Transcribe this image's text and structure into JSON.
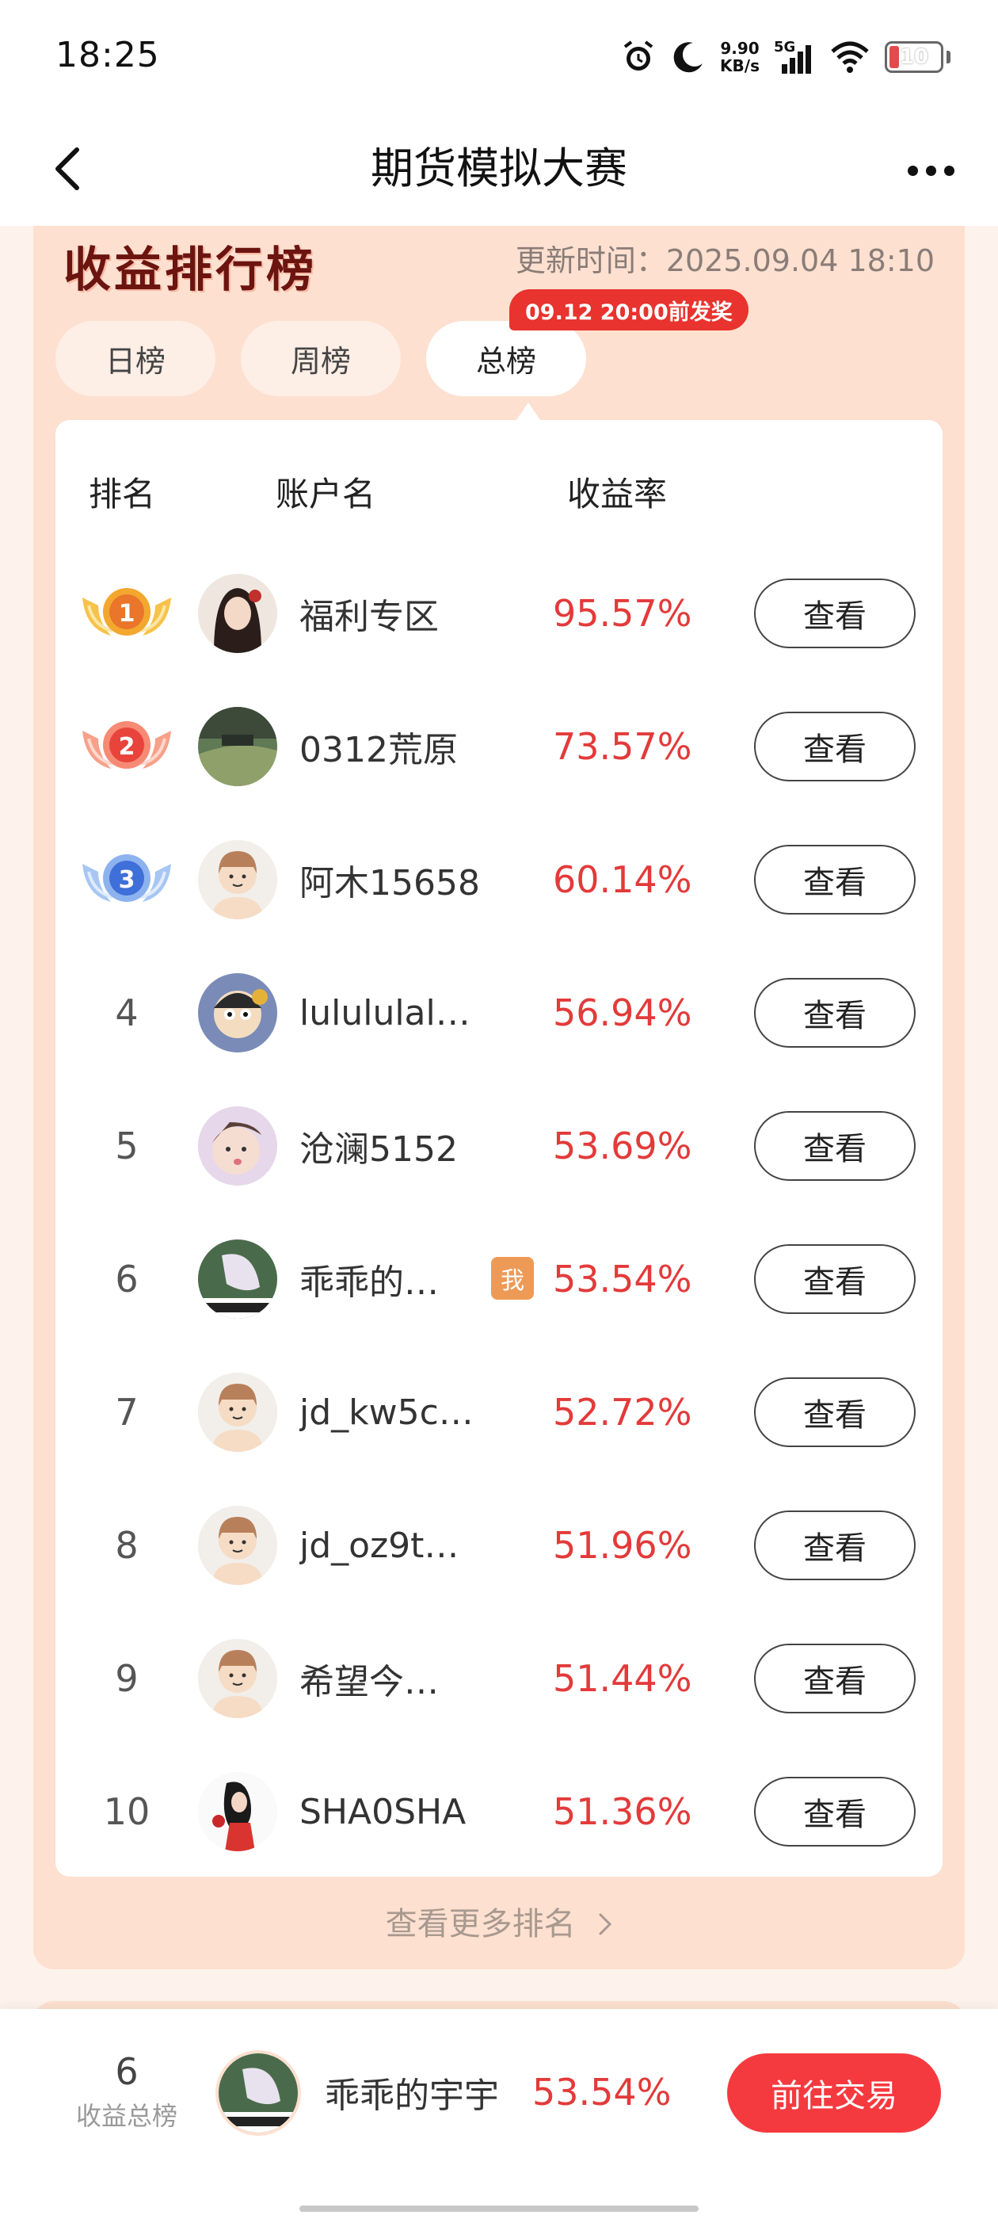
{
  "status_bar": {
    "time": "18:25",
    "net_speed_value": "9.90",
    "net_speed_unit": "KB/s",
    "signal_label": "5G",
    "battery": "10",
    "icons": [
      "alarm-icon",
      "moon-icon",
      "signal-icon",
      "wifi-icon",
      "battery-icon"
    ]
  },
  "header": {
    "title": "期货模拟大赛",
    "back_icon": "back-arrow-icon",
    "more_icon": "more-dots-icon"
  },
  "ranking": {
    "title": "收益排行榜",
    "update_time": "更新时间：2025.09.04 18:10",
    "tabs": [
      {
        "label": "日榜",
        "active": false
      },
      {
        "label": "周榜",
        "active": false
      },
      {
        "label": "总榜",
        "active": true
      }
    ],
    "award_badge": "09.12 20:00前发奖",
    "columns": {
      "rank": "排名",
      "account": "账户名",
      "rate": "收益率"
    },
    "rows": [
      {
        "rank": "1",
        "name": "福利专区",
        "rate": "95.57%",
        "button": "查看",
        "me": false
      },
      {
        "rank": "2",
        "name": "0312荒原",
        "rate": "73.57%",
        "button": "查看",
        "me": false
      },
      {
        "rank": "3",
        "name": "阿木15658",
        "rate": "60.14%",
        "button": "查看",
        "me": false
      },
      {
        "rank": "4",
        "name": "lulululal…",
        "rate": "56.94%",
        "button": "查看",
        "me": false
      },
      {
        "rank": "5",
        "name": "沧澜5152",
        "rate": "53.69%",
        "button": "查看",
        "me": false
      },
      {
        "rank": "6",
        "name": "乖乖的…",
        "rate": "53.54%",
        "button": "查看",
        "me": true,
        "me_label": "我"
      },
      {
        "rank": "7",
        "name": "jd_kw5c…",
        "rate": "52.72%",
        "button": "查看",
        "me": false
      },
      {
        "rank": "8",
        "name": "jd_oz9t…",
        "rate": "51.96%",
        "button": "查看",
        "me": false
      },
      {
        "rank": "9",
        "name": "希望今…",
        "rate": "51.44%",
        "button": "查看",
        "me": false
      },
      {
        "rank": "10",
        "name": "SHA0SHA",
        "rate": "51.36%",
        "button": "查看",
        "me": false
      }
    ],
    "more_link": "查看更多排名"
  },
  "my_info": {
    "rank": "6",
    "rank_label": "收益总榜",
    "name": "乖乖的宇宇",
    "rate": "53.54%",
    "trade_button": "前往交易"
  },
  "colors": {
    "accent_red": "#f53a3f",
    "rate_red": "#e33a3a",
    "panel_bg": "#fde0d0",
    "me_badge": "#ee9a57"
  }
}
